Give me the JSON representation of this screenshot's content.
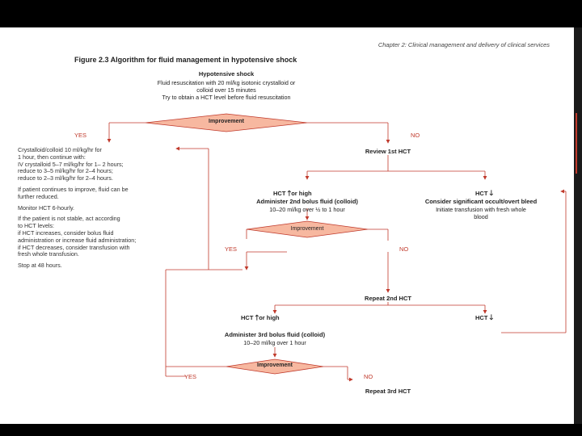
{
  "header": "Chapter 2: Clinical management and delivery of clinical services",
  "figure_title": "Figure 2.3 Algorithm for fluid management in hypotensive shock",
  "intro": {
    "title": "Hypotensive shock",
    "line1": "Fluid resuscitation with 20 ml/kg isotonic crystalloid or",
    "line2": "colloid over 15 minutes",
    "line3": "Try to obtain a HCT level before fluid resuscitation"
  },
  "decision1": {
    "label": "Improvement",
    "yes": "YES",
    "no": "NO"
  },
  "left_box": {
    "p1": [
      "Crystalloid/colloid 10 ml/kg/hr for",
      "1 hour, then continue with:",
      "IV crystalloid 5–7 ml/kg/hr for 1– 2 hours;",
      "reduce to 3–5 ml/kg/hr for 2–4 hours;",
      "reduce to 2–3 ml/kg/hr for 2–4 hours."
    ],
    "p2": [
      "If patient continues to improve, fluid can be",
      "further reduced."
    ],
    "p3": [
      "Monitor HCT 6-hourly."
    ],
    "p4": [
      "If the patient is not stable, act according",
      "to HCT levels:",
      "if HCT increases, consider bolus fluid",
      "administration or increase fluid administration;",
      "if HCT decreases, consider transfusion with",
      "fresh whole transfusion."
    ],
    "p5": [
      "Stop at 48 hours."
    ]
  },
  "review1": "Review 1st HCT",
  "hct_high1": {
    "prefix": "HCT",
    "suffix": "or high"
  },
  "hct_low1": {
    "prefix": "HCT"
  },
  "bolus2": {
    "title": "Administer 2nd bolus fluid (colloid)",
    "detail": "10–20 ml/kg over ½ to 1 hour"
  },
  "bleed": {
    "title": "Consider significant occult/overt bleed",
    "line1": "Initiate transfusion with fresh whole",
    "line2": "blood"
  },
  "decision2": {
    "label": "Improvement",
    "yes": "YES",
    "no": "NO"
  },
  "repeat2": "Repeat 2nd HCT",
  "hct_high2": {
    "prefix": "HCT",
    "suffix": "or high"
  },
  "hct_low2": {
    "prefix": "HCT"
  },
  "bolus3": {
    "title": "Administer 3rd bolus fluid (colloid)",
    "detail": "10–20 ml/kg over 1 hour"
  },
  "decision3": {
    "label": "Improvement",
    "yes": "YES",
    "no": "NO"
  },
  "repeat3": "Repeat 3rd HCT",
  "colors": {
    "diamond_fill": "#f7b8a0",
    "diamond_stroke": "#c0392b",
    "line": "#c0392b",
    "label_red": "#c0392b"
  }
}
